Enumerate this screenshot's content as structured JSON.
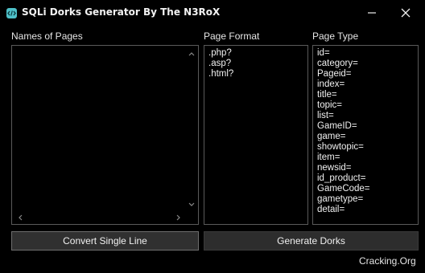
{
  "window": {
    "title": "SQLi Dorks Generator By The N3RoX"
  },
  "labels": {
    "names_of_pages": "Names of Pages",
    "page_format": "Page Format",
    "page_type": "Page Type"
  },
  "page_format": {
    "items": [
      ".php?",
      ".asp?",
      ".html?"
    ]
  },
  "page_type": {
    "items": [
      "id=",
      "category=",
      "Pageid=",
      "index=",
      "title=",
      "topic=",
      "list=",
      "GameID=",
      "game=",
      "showtopic=",
      "item=",
      "newsid=",
      "id_product=",
      "GameCode=",
      "gametype=",
      "detail="
    ]
  },
  "buttons": {
    "convert": "Convert Single Line",
    "generate": "Generate Dorks"
  },
  "footer": {
    "credit": "Cracking.Org"
  },
  "colors": {
    "background": "#000000",
    "text": "#e6e6e6",
    "button_bg": "#303030",
    "border": "#5a5a5a",
    "icon_accent": "#4ec0c8"
  }
}
